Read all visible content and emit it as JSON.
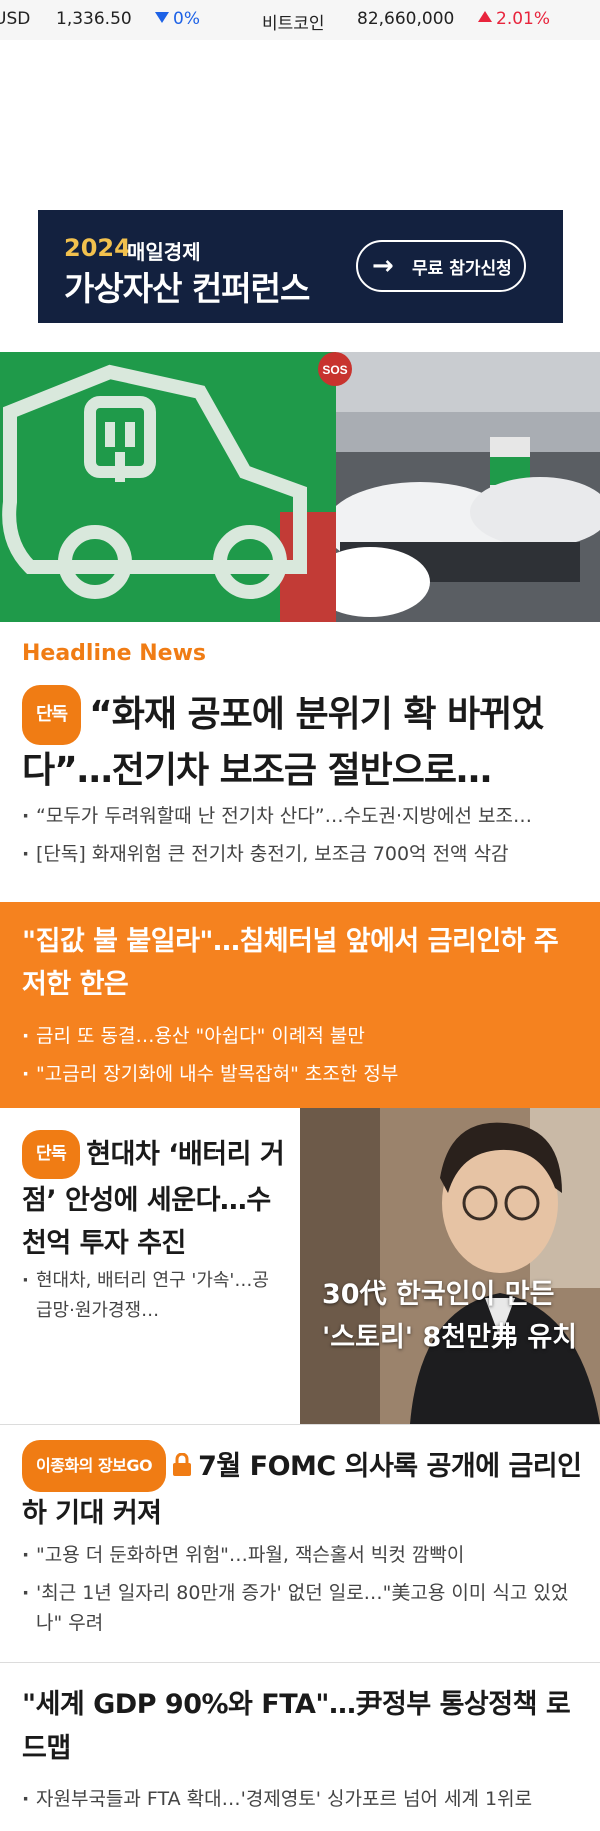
{
  "ticker": {
    "usd_label": "USD",
    "usd_value": "1,336.50",
    "usd_change": "0%",
    "usd_direction": "down",
    "btc_label": "비트코인",
    "btc_value": "82,660,000",
    "btc_change": "2.01%",
    "btc_direction": "up",
    "colors": {
      "up": "#e8243c",
      "down": "#1e62e6"
    }
  },
  "banner": {
    "year": "2024",
    "org": "매일경제",
    "title": "가상자산 컨퍼런스",
    "cta": "무료 참가신청",
    "icon": "arrow-right-icon"
  },
  "hero": {
    "sign_text": "SOS"
  },
  "headline": {
    "section_label": "Headline News",
    "badge": "단독",
    "title": "“화재 공포에 분위기 확 바뀌었다”…전기차 보조금 절반으로…",
    "bullets": [
      "“모두가 두려워할때 난 전기차 산다”…수도권·지방에선 보조…",
      "[단독] 화재위험 큰 전기차 충전기, 보조금 700억 전액 삭감"
    ]
  },
  "orange_block": {
    "title": "\"집값 불 붙일라\"…침체터널 앞에서 금리인하 주저한 한은",
    "bullets": [
      "금리 또 동결…용산 \"아쉽다\" 이례적 불만",
      "\"고금리 장기화에 내수 발목잡혀\" 초조한 정부"
    ],
    "color": "#f5821f"
  },
  "two_column": {
    "left": {
      "badge": "단독",
      "title": "현대차 ‘배터리 거점’ 안성에 세운다…수천억 투자 추진",
      "bullets": [
        "현대차, 배터리 연구 '가속'…공급망·원가경쟁…"
      ]
    },
    "right": {
      "caption": "30代 한국인이 만든 '스토리' 8천만弗 유치"
    }
  },
  "fomc": {
    "badge": "이종화의 장보GO",
    "lock_icon": "lock-icon",
    "title": "7월 FOMC 의사록 공개에 금리인하 기대 커져",
    "bullets": [
      "\"고용 더 둔화하면 위험\"…파월, 잭슨홀서 빅컷 깜빡이",
      "'최근 1년 일자리 80만개 증가' 없던 일로…\"美고용 이미 식고 있었나\" 우려"
    ]
  },
  "gdp": {
    "title": "\"세계 GDP 90%와 FTA\"…尹정부 통상정책 로드맵",
    "bullets": [
      "자원부국들과 FTA 확대…'경제영토' 싱가포르 넘어 세계 1위로"
    ]
  }
}
